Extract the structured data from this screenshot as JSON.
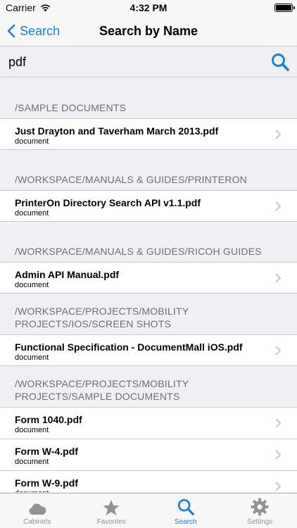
{
  "status_bar": {
    "carrier": "Carrier",
    "time": "4:32 PM"
  },
  "nav": {
    "back_label": "Search",
    "title": "Search by Name"
  },
  "search": {
    "query": "pdf",
    "icon": "search-icon"
  },
  "sections": [
    {
      "header": "/SAMPLE DOCUMENTS",
      "items": [
        {
          "title": "Just Drayton and Taverham March 2013.pdf",
          "subtitle": "document"
        }
      ]
    },
    {
      "header": "/WORKSPACE/MANUALS & GUIDES/PRINTERON",
      "items": [
        {
          "title": "PrinterOn Directory Search API v1.1.pdf",
          "subtitle": "document"
        }
      ]
    },
    {
      "header": "/WORKSPACE/MANUALS & GUIDES/RICOH GUIDES",
      "items": [
        {
          "title": "Admin API Manual.pdf",
          "subtitle": "document"
        }
      ]
    },
    {
      "header": "/WORKSPACE/PROJECTS/MOBILITY PROJECTS/IOS/SCREEN SHOTS",
      "items": [
        {
          "title": "Functional Specification - DocumentMall iOS.pdf",
          "subtitle": "document"
        }
      ]
    },
    {
      "header": "/WORKSPACE/PROJECTS/MOBILITY PROJECTS/SAMPLE DOCUMENTS",
      "items": [
        {
          "title": "Form 1040.pdf",
          "subtitle": "document"
        },
        {
          "title": "Form W-4.pdf",
          "subtitle": "document"
        },
        {
          "title": "Form W-9.pdf",
          "subtitle": "document"
        }
      ]
    }
  ],
  "tabs": [
    {
      "label": "Cabinets",
      "icon": "cloud-icon",
      "active": false
    },
    {
      "label": "Favorites",
      "icon": "star-icon",
      "active": false
    },
    {
      "label": "Search",
      "icon": "search-icon",
      "active": true
    },
    {
      "label": "Settings",
      "icon": "gear-icon",
      "active": false
    }
  ],
  "colors": {
    "accent": "#1a7ee6",
    "tab_inactive": "#929292",
    "background": "#efeff4"
  }
}
